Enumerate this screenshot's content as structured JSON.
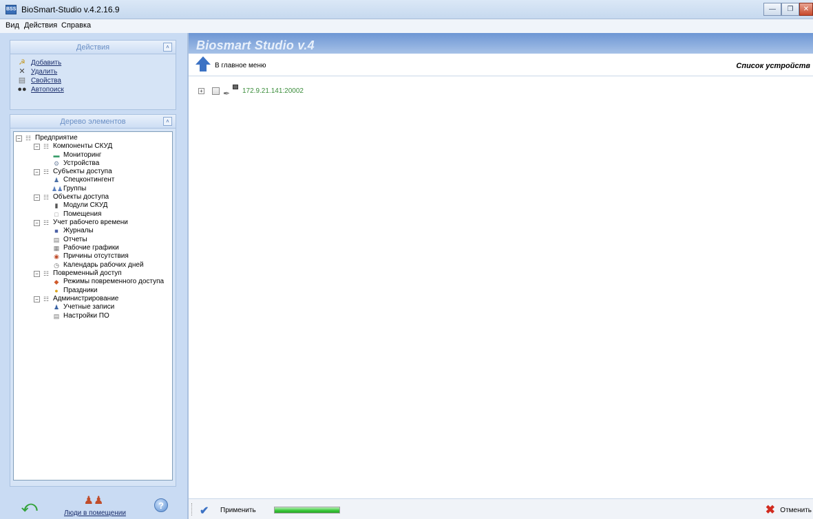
{
  "window": {
    "title": "BioSmart-Studio v.4.2.16.9",
    "icon": "BSS"
  },
  "menu": [
    "Вид",
    "Действия",
    "Справка"
  ],
  "actions_panel": {
    "title": "Действия",
    "items": [
      {
        "label": "Добавить",
        "icon": "add-icon"
      },
      {
        "label": "Удалить",
        "icon": "delete-icon"
      },
      {
        "label": "Свойства",
        "icon": "properties-icon"
      },
      {
        "label": "Автопоиск",
        "icon": "binoculars-icon"
      }
    ]
  },
  "tree_panel": {
    "title": "Дерево элементов",
    "root": "Предприятие",
    "groups": [
      {
        "label": "Компоненты СКУД",
        "children": [
          "Мониторинг",
          "Устройства"
        ]
      },
      {
        "label": "Субъекты доступа",
        "children": [
          "Спецконтингент",
          "Группы"
        ]
      },
      {
        "label": "Объекты доступа",
        "children": [
          "Модули СКУД",
          "Помещения"
        ]
      },
      {
        "label": "Учет рабочего времени",
        "children": [
          "Журналы",
          "Отчеты",
          "Рабочие графики",
          "Причины отсутствия",
          "Календарь рабочих дней"
        ]
      },
      {
        "label": "Повременный доступ",
        "children": [
          "Режимы повременного доступа",
          "Праздники"
        ]
      },
      {
        "label": "Администрирование",
        "children": [
          "Учетные записи",
          "Настройки ПО"
        ]
      }
    ]
  },
  "bottom_left": {
    "people_link": "Люди в помещении"
  },
  "header": {
    "brand": "Biosmart Studio v.4"
  },
  "toolbar": {
    "home_label": "В главное меню",
    "section_title": "Список устройств"
  },
  "devices": [
    {
      "address": "172.9.21.141:20002"
    }
  ],
  "statusbar": {
    "apply_label": "Применить",
    "cancel_label": "Отменить",
    "progress": 1.0
  }
}
